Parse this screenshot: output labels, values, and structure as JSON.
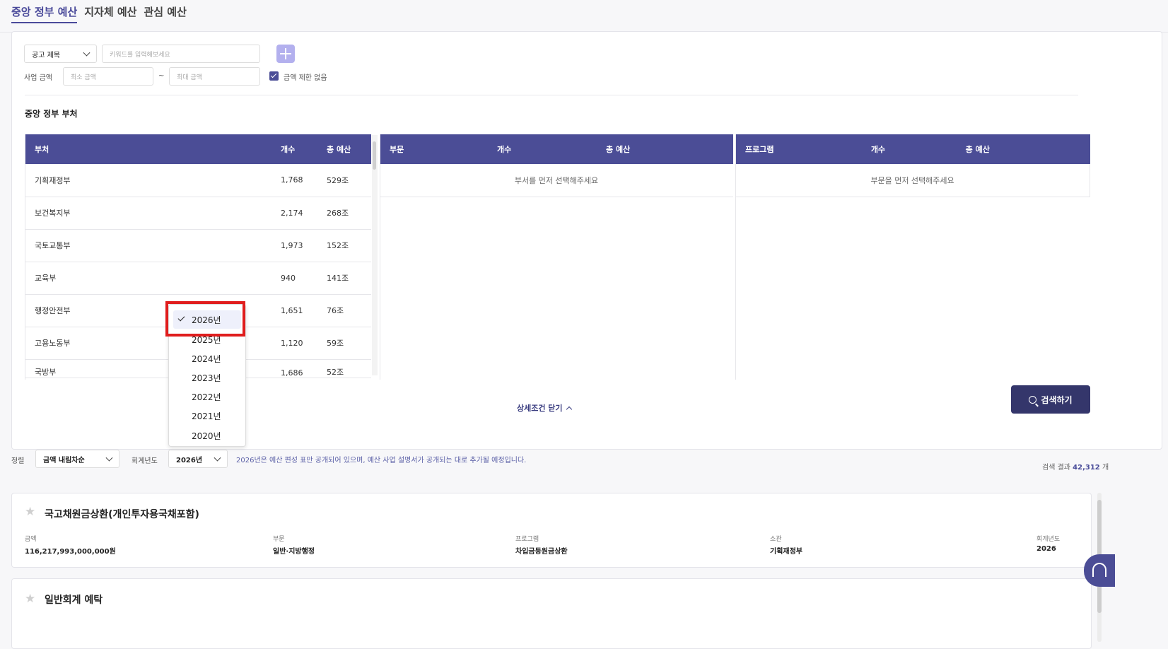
{
  "tabs": [
    "중앙 정부 예산",
    "지자체 예산",
    "관심 예산"
  ],
  "filter": {
    "title_select": "공고 제목",
    "keyword_placeholder": "키워드를 입력해보세요",
    "amount_label": "사업 금액",
    "min_placeholder": "최소 금액",
    "tilde": "~",
    "max_placeholder": "최대 금액",
    "no_limit_label": "금액 제한 없음",
    "no_limit_checked": true
  },
  "section_title": "중앙 정부 부처",
  "departments": {
    "headers": [
      "부처",
      "개수",
      "총 예산"
    ],
    "rows": [
      {
        "name": "기획재정부",
        "count": "1,768",
        "budget": "529조"
      },
      {
        "name": "보건복지부",
        "count": "2,174",
        "budget": "268조"
      },
      {
        "name": "국토교통부",
        "count": "1,973",
        "budget": "152조"
      },
      {
        "name": "교육부",
        "count": "940",
        "budget": "141조"
      },
      {
        "name": "행정안전부",
        "count": "1,651",
        "budget": "76조"
      },
      {
        "name": "고용노동부",
        "count": "1,120",
        "budget": "59조"
      },
      {
        "name": "국방부",
        "count": "1,686",
        "budget": "52조"
      }
    ]
  },
  "sectors": {
    "headers": [
      "부문",
      "개수",
      "총 예산"
    ],
    "empty": "부서를 먼저 선택해주세요"
  },
  "programs": {
    "headers": [
      "프로그램",
      "개수",
      "총 예산"
    ],
    "empty": "부문을 먼저 선택해주세요"
  },
  "close_detail": "상세조건 닫기",
  "search_button": "검색하기",
  "sort": {
    "label": "정렬",
    "value": "금액 내림차순"
  },
  "fiscal_year": {
    "label": "회계년도",
    "value": "2026년"
  },
  "notice": "2026년은 예산 편성 표만 공개되어 있으며, 예산 사업 설명서가 공개되는 대로 추가될 예정입니다.",
  "result": {
    "prefix": "검색 결과",
    "count": "42,312",
    "suffix": "개"
  },
  "year_dropdown": {
    "selected": "2026년",
    "options": [
      "2026년",
      "2025년",
      "2024년",
      "2023년",
      "2022년",
      "2021년",
      "2020년"
    ]
  },
  "cards": [
    {
      "title": "국고채원금상환(개인투자용국채포함)",
      "fields": [
        {
          "label": "금액",
          "value": "116,217,993,000,000원"
        },
        {
          "label": "부문",
          "value": "일반·지방행정"
        },
        {
          "label": "프로그램",
          "value": "차입금등원금상환"
        },
        {
          "label": "소관",
          "value": "기획재정부"
        },
        {
          "label": "회계년도",
          "value": "2026"
        }
      ]
    },
    {
      "title": "일반회계 예탁"
    }
  ]
}
